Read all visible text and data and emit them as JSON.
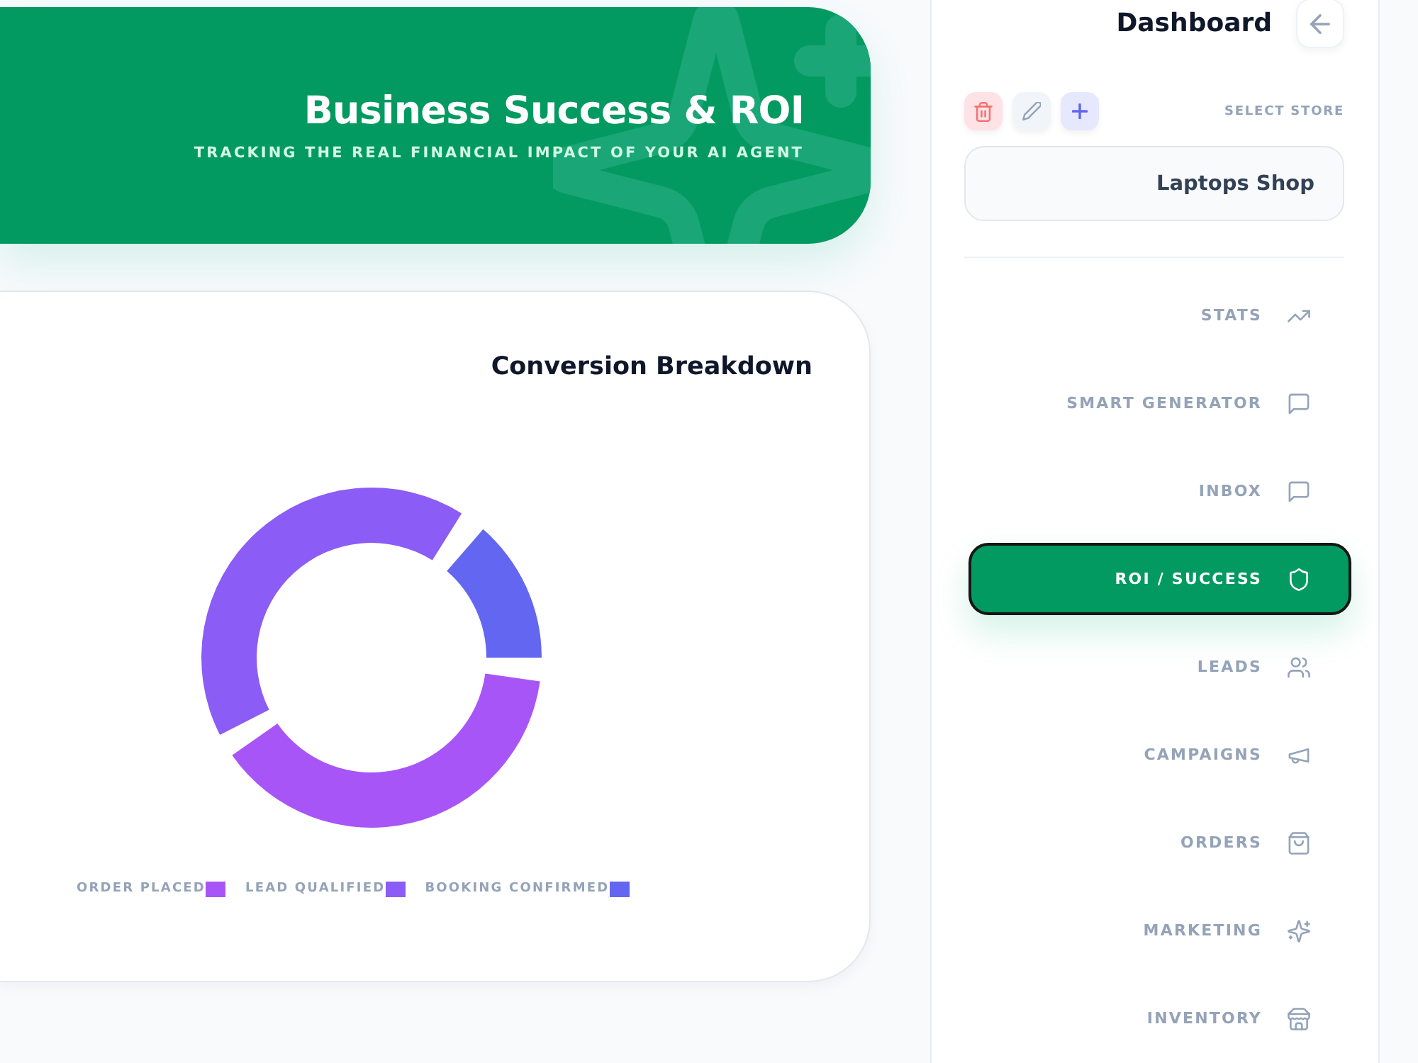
{
  "banner": {
    "title": "Business Success & ROI",
    "subtitle": "TRACKING THE REAL FINANCIAL IMPACT OF YOUR AI AGENT"
  },
  "conversion": {
    "title": "Conversion Breakdown",
    "legend": [
      {
        "label": "ORDER PLACED",
        "color": "#a855f7"
      },
      {
        "label": "LEAD QUALIFIED",
        "color": "#8b5cf6"
      },
      {
        "label": "BOOKING CONFIRMED",
        "color": "#6366f1"
      }
    ]
  },
  "sidebar": {
    "title": "Dashboard",
    "store_label": "SELECT STORE",
    "store": "Laptops Shop",
    "nav": [
      {
        "label": "STATS",
        "selected": false
      },
      {
        "label": "SMART GENERATOR",
        "selected": false
      },
      {
        "label": "INBOX",
        "selected": false
      },
      {
        "label": "ROI / SUCCESS",
        "selected": true
      },
      {
        "label": "LEADS",
        "selected": false
      },
      {
        "label": "CAMPAIGNS",
        "selected": false
      },
      {
        "label": "ORDERS",
        "selected": false
      },
      {
        "label": "MARKETING",
        "selected": false
      },
      {
        "label": "INVENTORY",
        "selected": false
      }
    ]
  }
}
